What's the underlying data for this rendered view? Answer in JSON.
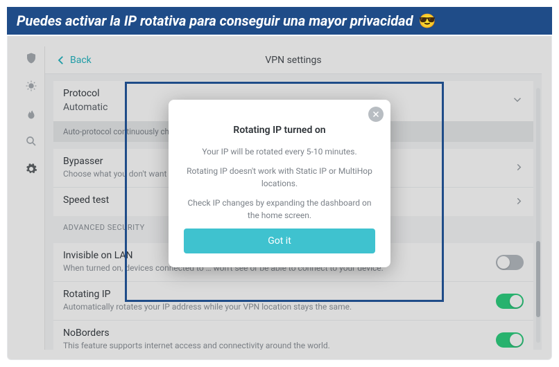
{
  "banner": {
    "text": "Puedes activar la IP rotativa para conseguir una mayor privacidad",
    "emoji": "😎"
  },
  "header": {
    "back": "Back",
    "title": "VPN settings"
  },
  "protocol": {
    "label": "Protocol",
    "value": "Automatic",
    "hint": "Auto-protocol continuously cho"
  },
  "bypasser": {
    "label": "Bypasser",
    "sub": "Choose what you don't want to …"
  },
  "speedtest": {
    "label": "Speed test"
  },
  "groups": {
    "advanced": "ADVANCED SECURITY"
  },
  "invisible": {
    "label": "Invisible on LAN",
    "sub": "When turned on, devices connected to … won't see or be able to connect to your device."
  },
  "rotating": {
    "label": "Rotating IP",
    "sub": "Automatically rotates your IP address while your VPN location stays the same."
  },
  "noborders": {
    "label": "NoBorders",
    "sub": "This feature supports internet access and connectivity around the world."
  },
  "modal": {
    "title": "Rotating IP turned on",
    "p1": "Your IP will be rotated every 5-10 minutes.",
    "p2": "Rotating IP doesn't work with Static IP or MultiHop locations.",
    "p3": "Check IP changes by expanding the dashboard on the home screen.",
    "button": "Got it"
  },
  "colors": {
    "accent": "#3fc2cf",
    "brand": "#1f4c88",
    "toggleOn": "#2ecf80"
  }
}
